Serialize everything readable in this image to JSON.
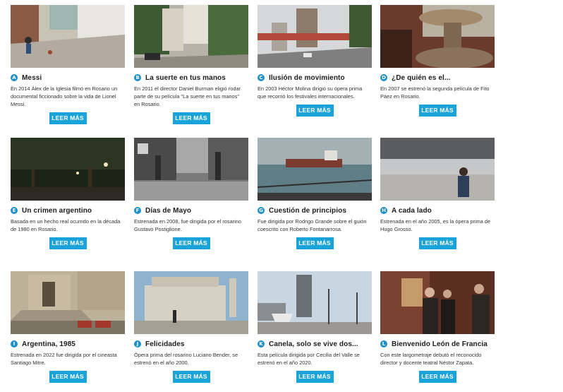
{
  "button_label": "LEER MÁS",
  "accent_color": "#1aa3d8",
  "films": [
    {
      "letter": "A",
      "title": "Messi",
      "desc": "En 2014 Álex de la Iglesia filmó en Rosario un documental ficcionado sobre la vida de Lionel Messi."
    },
    {
      "letter": "B",
      "title": "La suerte en tus manos",
      "desc": "En 2011 el director Daniel Burman eligió rodar parte de su película \"La suerte en tus manos\" en Rosario."
    },
    {
      "letter": "C",
      "title": "Ilusión de movimiento",
      "desc": "En 2003 Héctor Molina dirigió su ópera prima que recorrió los festivales internacionales."
    },
    {
      "letter": "D",
      "title": "¿De quién es el...",
      "desc": "En 2007 se estrenó la segunda película de Fito Páez en Rosario."
    },
    {
      "letter": "E",
      "title": "Un crimen argentino",
      "desc": "Basada en un hecho real ocurrido en la década de 1980 en Rosario."
    },
    {
      "letter": "F",
      "title": "Días de Mayo",
      "desc": "Estrenada en 2008, fue dirigida por el rosarino Gustavo Postiglione."
    },
    {
      "letter": "G",
      "title": "Cuestión de principios",
      "desc": "Fue dirigida por Rodrigo Grande sobre el guión coescrito con Roberto Fontanarrosa."
    },
    {
      "letter": "H",
      "title": "A cada lado",
      "desc": "Estrenada en el año 2005, es la ópera prima de Hugo Grosso."
    },
    {
      "letter": "I",
      "title": "Argentina, 1985",
      "desc": "Estrenada en 2022 fue dirigida por el cineasta Santiago Mitre."
    },
    {
      "letter": "J",
      "title": "Felicidades",
      "desc": "Ópera prima del rosarino Luciano Bender, se estrenó en el año 2000."
    },
    {
      "letter": "K",
      "title": "Canela, solo se vive dos...",
      "desc": "Esta película dirigida por Cecilia del Valle se estrenó en el año 2020."
    },
    {
      "letter": "L",
      "title": "Bienvenido León de Francia",
      "desc": "Con este largometraje debutó el reconocido director y docente teatral Néstor Zapata."
    }
  ],
  "thumb_icons": [
    "street-scene",
    "city-street",
    "highway",
    "fountain",
    "night-park",
    "black-white-street",
    "river-ship",
    "building-terrace",
    "cathedral-steps",
    "monument",
    "city-skyline",
    "period-interior"
  ]
}
